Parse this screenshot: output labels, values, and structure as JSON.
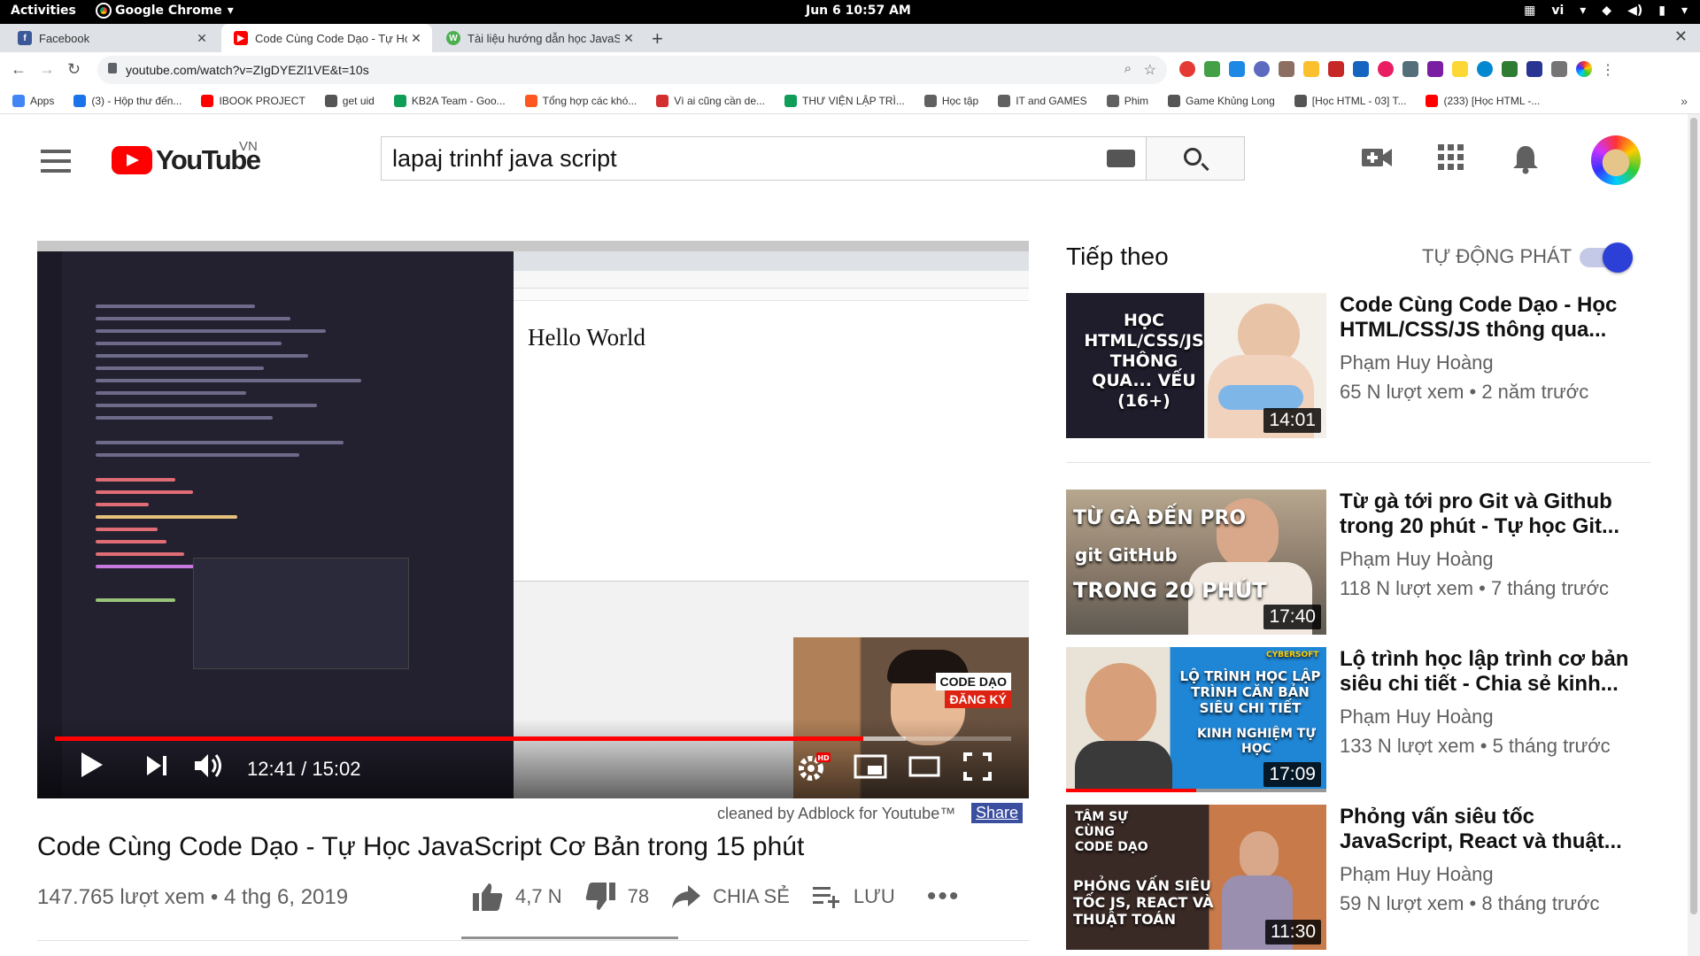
{
  "gnome": {
    "activities": "Activities",
    "app": "Google Chrome",
    "clock": "Jun 6  10:57 AM",
    "lang": "vi"
  },
  "tabs": [
    {
      "title": "Facebook"
    },
    {
      "title": "Code Cùng Code Dạo - Tự Học"
    },
    {
      "title": "Tài liệu hướng dẫn học JavaSc"
    }
  ],
  "omnibox": {
    "url": "youtube.com/watch?v=ZIgDYEZl1VE&t=10s"
  },
  "bookmarks": [
    {
      "label": "Apps",
      "color": "#4285f4"
    },
    {
      "label": "(3) - Hộp thư đến...",
      "color": "#1a73e8"
    },
    {
      "label": "IBOOK PROJECT",
      "color": "#ff0000"
    },
    {
      "label": "get uid",
      "color": "#555555"
    },
    {
      "label": "KB2A Team - Goo...",
      "color": "#0f9d58"
    },
    {
      "label": "Tổng hợp các khó...",
      "color": "#ff5722"
    },
    {
      "label": "Vì ai cũng cần de...",
      "color": "#d32f2f"
    },
    {
      "label": "THƯ VIỆN LẬP TRÌ...",
      "color": "#0f9d58"
    },
    {
      "label": "Học tập",
      "color": "#616161"
    },
    {
      "label": "IT and GAMES",
      "color": "#616161"
    },
    {
      "label": "Phim",
      "color": "#616161"
    },
    {
      "label": "Game Khủng Long",
      "color": "#555555"
    },
    {
      "label": "[Học HTML - 03] T...",
      "color": "#555555"
    },
    {
      "label": "(233) [Học HTML -...",
      "color": "#ff0000"
    }
  ],
  "youtube": {
    "logo_text": "YouTube",
    "country": "VN",
    "search_value": "lapaj trinhf java script"
  },
  "player": {
    "hello_text": "Hello World",
    "cam_badge_1": "CODE DẠO",
    "cam_badge_2": "ĐĂNG KÝ",
    "time": "12:41 / 15:02",
    "progress": 0.845,
    "hd_badge": "HD"
  },
  "video": {
    "adblock_note": "cleaned by Adblock for Youtube™",
    "share_link": "Share",
    "title": "Code Cùng Code Dạo - Tự Học JavaScript Cơ Bản trong 15 phút",
    "views": "147.765 lượt xem • 4 thg 6, 2019",
    "likes": "4,7 N",
    "dislikes": "78",
    "share": "CHIA SẺ",
    "save": "LƯU"
  },
  "sidebar": {
    "up_next": "Tiếp theo",
    "autoplay": "TỰ ĐỘNG PHÁT",
    "videos": [
      {
        "title": "Code Cùng Code Dạo - Học HTML/CSS/JS thông qua...",
        "channel": "Phạm Huy Hoàng",
        "meta": "65 N lượt xem • 2 năm trước",
        "duration": "14:01",
        "thumb_text": "HỌC HTML/CSS/JS THÔNG QUA... VẾU (16+)"
      },
      {
        "title": "Từ gà tới pro Git và Github trong 20 phút - Tự học Git...",
        "channel": "Phạm Huy Hoàng",
        "meta": "118 N lượt xem • 7 tháng trước",
        "duration": "17:40",
        "thumb_text": "TỪ GÀ ĐẾN PRO",
        "thumb_text2": "git   GitHub",
        "thumb_text3": "TRONG 20 PHÚT"
      },
      {
        "title": "Lộ trình học lập trình cơ bản siêu chi tiết - Chia sẻ kinh...",
        "channel": "Phạm Huy Hoàng",
        "meta": "133 N lượt xem • 5 tháng trước",
        "duration": "17:09",
        "thumb_text": "LỘ TRÌNH HỌC LẬP TRÌNH CĂN BẢN SIÊU CHI TIẾT",
        "thumb_text2": "KINH NGHIỆM TỰ HỌC",
        "thumb_text3": "CYBERSOFT"
      },
      {
        "title": "Phỏng vấn siêu tốc JavaScript, React và thuật...",
        "channel": "Phạm Huy Hoàng",
        "meta": "59 N lượt xem • 8 tháng trước",
        "duration": "11:30",
        "thumb_text": "TÂM SỰ CÙNG CODE DẠO",
        "thumb_text2": "PHỎNG VẤN SIÊU TỐC JS, REACT VÀ THUẬT TOÁN"
      }
    ]
  }
}
